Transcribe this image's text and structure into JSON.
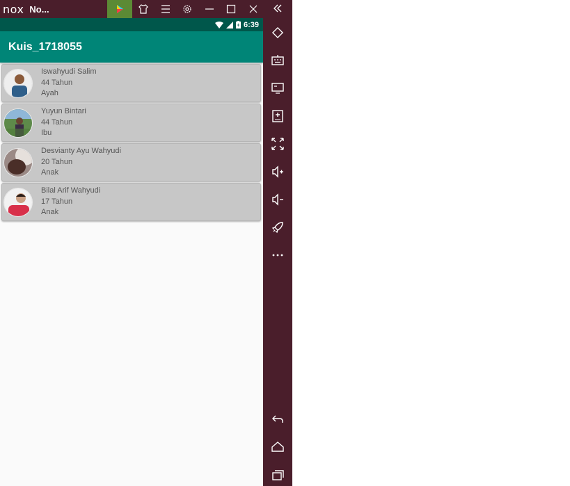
{
  "window": {
    "brand": "nox",
    "title": "No..."
  },
  "status_bar": {
    "time": "6:39",
    "battery_icon": "battery-icon",
    "signal_icon": "signal-icon",
    "wifi_icon": "wifi-icon"
  },
  "app_bar": {
    "title": "Kuis_1718055",
    "color": "#008577"
  },
  "people": [
    {
      "name": "Iswahyudi Salim",
      "age": "44 Tahun",
      "role": "Ayah"
    },
    {
      "name": "Yuyun Bintari",
      "age": "44 Tahun",
      "role": "Ibu"
    },
    {
      "name": "Desvianty Ayu Wahyudi",
      "age": "20 Tahun",
      "role": "Anak"
    },
    {
      "name": "Bilal Arif Wahyudi",
      "age": "17 Tahun",
      "role": "Anak"
    }
  ],
  "colors": {
    "emulator_frame": "#4a1e2b",
    "status_bar": "#00574b",
    "card": "#c7c7c7",
    "play_button_bg": "#5c8a35"
  }
}
